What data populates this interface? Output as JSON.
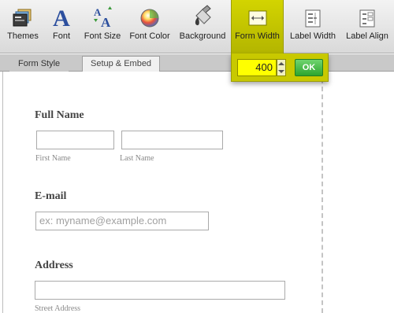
{
  "toolbar": {
    "items": [
      {
        "label": "Themes",
        "icon": "themes-icon"
      },
      {
        "label": "Font",
        "icon": "font-icon"
      },
      {
        "label": "Font Size",
        "icon": "font-size-icon"
      },
      {
        "label": "Font Color",
        "icon": "font-color-icon"
      },
      {
        "label": "Background",
        "icon": "background-icon"
      },
      {
        "label": "Form Width",
        "icon": "form-width-icon",
        "active": true
      },
      {
        "label": "Label Width",
        "icon": "label-width-icon"
      },
      {
        "label": "Label Align",
        "icon": "label-align-icon"
      }
    ]
  },
  "tabs": [
    {
      "label": "Form Style",
      "active": false
    },
    {
      "label": "Setup & Embed",
      "active": true
    }
  ],
  "width_popup": {
    "value": "400",
    "ok_label": "OK"
  },
  "form": {
    "full_name": {
      "label": "Full Name",
      "first_sublabel": "First Name",
      "last_sublabel": "Last Name"
    },
    "email": {
      "label": "E-mail",
      "placeholder": "ex: myname@example.com"
    },
    "address": {
      "label": "Address",
      "street_sublabel": "Street Address"
    }
  },
  "colors": {
    "active_tool": "#c8c900",
    "width_input": "#ffff00",
    "ok_button": "#3cb43c"
  }
}
